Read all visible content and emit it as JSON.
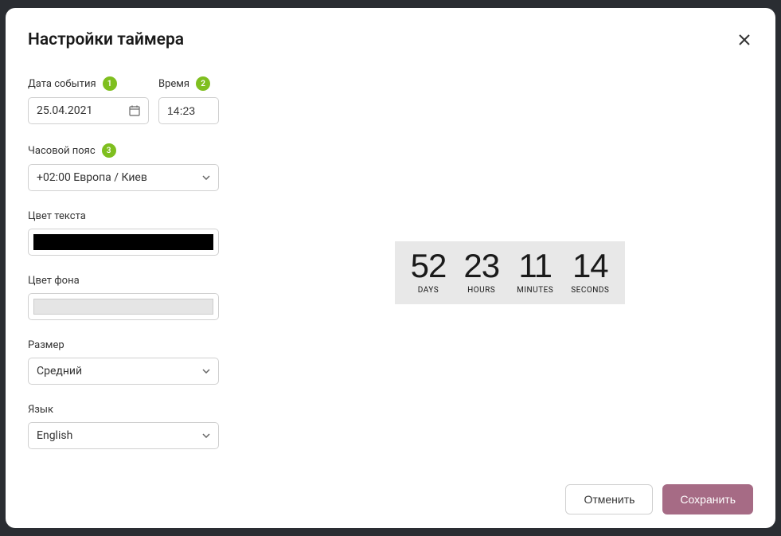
{
  "modal": {
    "title": "Настройки таймера"
  },
  "form": {
    "dateLabel": "Дата события",
    "dateValue": "25.04.2021",
    "dateBadge": "1",
    "timeLabel": "Время",
    "timeValue": "14:23",
    "timeBadge": "2",
    "timezoneLabel": "Часовой пояс",
    "timezoneValue": "+02:00 Европа / Киев",
    "timezoneBadge": "3",
    "textColorLabel": "Цвет текста",
    "textColorValue": "#000000",
    "bgColorLabel": "Цвет фона",
    "bgColorValue": "#e5e5e5",
    "sizeLabel": "Размер",
    "sizeValue": "Средний",
    "languageLabel": "Язык",
    "languageValue": "English"
  },
  "preview": {
    "days": "52",
    "daysLabel": "DAYS",
    "hours": "23",
    "hoursLabel": "HOURS",
    "minutes": "11",
    "minutesLabel": "MINUTES",
    "seconds": "14",
    "secondsLabel": "SECONDS"
  },
  "footer": {
    "cancel": "Отменить",
    "save": "Сохранить"
  }
}
